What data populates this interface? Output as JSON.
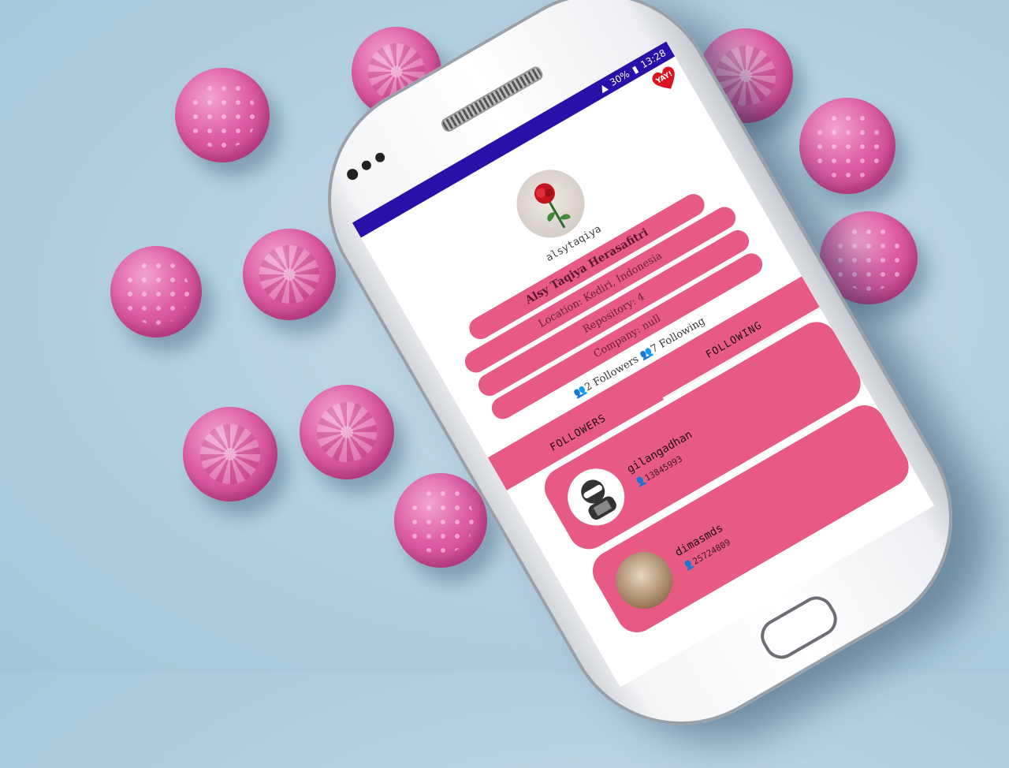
{
  "status_bar": {
    "battery": "30%",
    "time": "13:28"
  },
  "app_bar": {
    "favorite_label": "YAY!"
  },
  "profile": {
    "username": "alsytaqiya",
    "name": "Alsy Taqiya Herasafitri",
    "location": "Location: Kediri, Indonesia",
    "repository": "Repository: 4",
    "company": "Company: null",
    "followers_text": "2 Followers",
    "following_text": "7 Following"
  },
  "tabs": [
    {
      "label": "FOLLOWERS",
      "active": false
    },
    {
      "label": "FOLLOWING",
      "active": true
    }
  ],
  "users": [
    {
      "login": "gilangadhan",
      "id": "13845993",
      "avatar_icon": "ninja-avatar-icon"
    },
    {
      "login": "dimasmds",
      "id": "25724809",
      "avatar_icon": "photo-avatar"
    }
  ],
  "colors": {
    "accent": "#e85a86",
    "status_bar": "#2a0fa8",
    "background": "#b3cfe0",
    "candy": "#dd5ea6"
  }
}
